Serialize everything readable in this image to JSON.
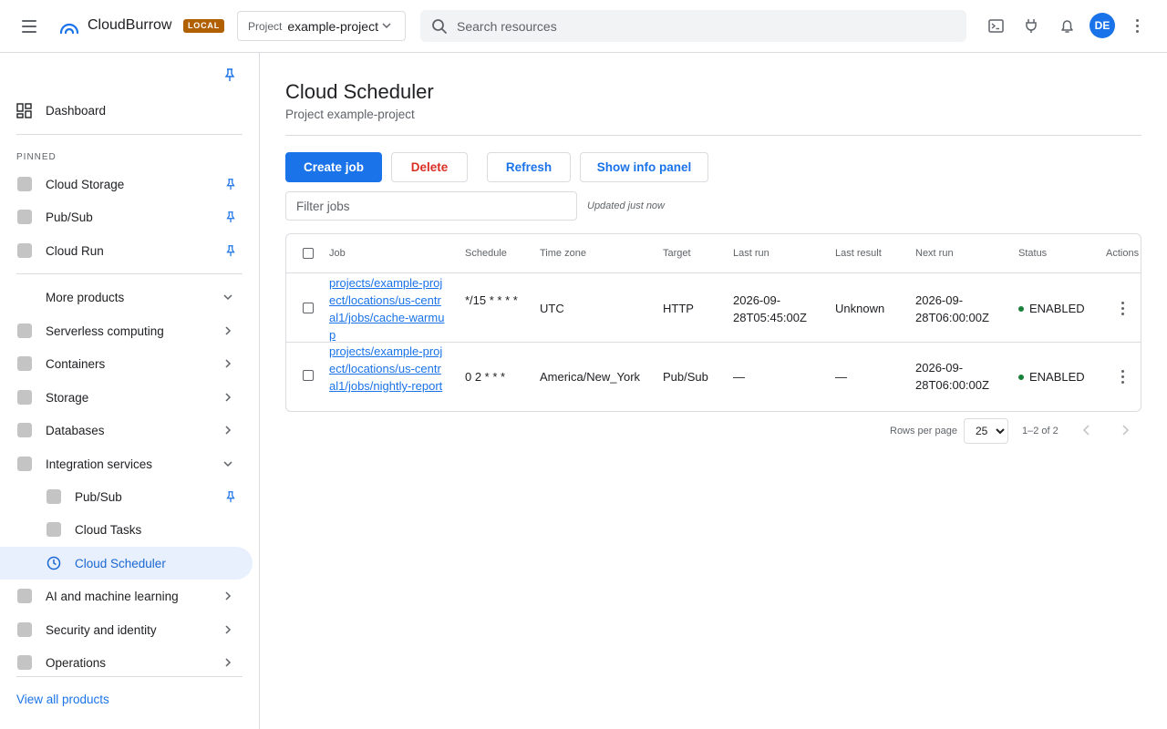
{
  "topbar": {
    "brand": "CloudBurrow",
    "env_badge": "LOCAL",
    "project_label": "Project",
    "project_value": "example-project",
    "search_placeholder": "Search resources",
    "avatar_initials": "DE"
  },
  "sidebar": {
    "dashboard": "Dashboard",
    "pinned_header": "PINNED",
    "pinned": [
      "Cloud Storage",
      "Pub/Sub",
      "Cloud Run"
    ],
    "more_products": "More products",
    "categories": [
      "Serverless computing",
      "Containers",
      "Storage",
      "Databases",
      "Integration services"
    ],
    "integration_children": [
      "Pub/Sub",
      "Cloud Tasks",
      "Cloud Scheduler"
    ],
    "more_categories": [
      "AI and machine learning",
      "Security and identity",
      "Operations"
    ],
    "view_all": "View all products",
    "active_item": "Cloud Scheduler"
  },
  "main": {
    "title": "Cloud Scheduler",
    "subtitle": "Project example-project",
    "buttons": {
      "create": "Create job",
      "delete": "Delete",
      "refresh": "Refresh",
      "info_panel": "Show info panel"
    },
    "filter_placeholder": "Filter jobs",
    "updated": "Updated just now",
    "columns": [
      "Job",
      "Schedule",
      "Time zone",
      "Target",
      "Last run",
      "Last result",
      "Next run",
      "Status",
      "Actions"
    ],
    "rows": [
      {
        "job": "projects/example-project/locations/us-central1/jobs/cache-warmup",
        "schedule": "*/15 * * * *",
        "timezone": "UTC",
        "target": "HTTP",
        "last_run": "2026-09-28T05:45:00Z",
        "last_result": "Unknown",
        "next_run": "2026-09-28T06:00:00Z",
        "status": "ENABLED"
      },
      {
        "job": "projects/example-project/locations/us-central1/jobs/nightly-report",
        "schedule": "0 2 * * *",
        "timezone": "America/New_York",
        "target": "Pub/Sub",
        "last_run": "—",
        "last_result": "—",
        "next_run": "2026-09-28T06:00:00Z",
        "status": "ENABLED"
      }
    ],
    "pager": {
      "rows_per_page_label": "Rows per page",
      "rows_per_page": "25",
      "range": "1–2 of 2"
    }
  },
  "colors": {
    "accent": "#1a73e8",
    "danger": "#d93025",
    "status_enabled": "#188038",
    "badge": "#b06000",
    "active_bg": "#e8f0fe"
  },
  "icons": [
    "menu-icon",
    "cloud-logo-icon",
    "chevron-down-icon",
    "search-icon",
    "terminal-icon",
    "plug-icon",
    "bell-icon",
    "more-vert-icon",
    "pin-icon",
    "dashboard-icon",
    "chevron-right-icon",
    "clock-icon",
    "chevron-left-icon"
  ]
}
